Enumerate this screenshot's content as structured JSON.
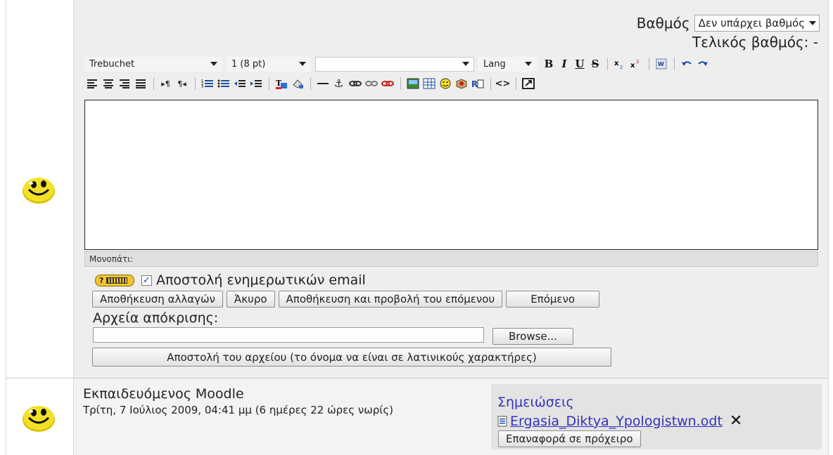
{
  "grading": {
    "grade_label": "Βαθμός",
    "grade_select_value": "Δεν υπάρχει βαθμός",
    "final_grade": "Τελικός βαθμός: -"
  },
  "editor": {
    "font_family": "Trebuchet",
    "font_size": "1 (8 pt)",
    "style_select": "",
    "lang_select": "Lang",
    "bold": "B",
    "italic": "I",
    "underline": "U",
    "strike": "S",
    "path_label": "Μονοπάτι:"
  },
  "feedback": {
    "email_label": "Αποστολή ενημερωτικών email",
    "email_checked": true,
    "save_button": "Αποθήκευση αλλαγών",
    "cancel_button": "Άκυρο",
    "save_next_button": "Αποθήκευση και προβολή του επόμενου",
    "next_button": "Επόμενο"
  },
  "response_files": {
    "label": "Αρχεία απόκρισης:",
    "browse_button": "Browse...",
    "upload_button": "Αποστολή του αρχείου (το όνομα να είναι σε λατινικούς χαρακτήρες)"
  },
  "submission": {
    "student_name": "Εκπαιδευόμενος Moodle",
    "date_text": "Τρίτη, 7 Ιούλιος 2009, 04:41 μμ (6 ημέρες 22 ώρες νωρίς)",
    "notes_link": "Σημειώσεις",
    "file_name": "Ergasia_Diktya_Ypologistwn.odt",
    "revert_button": "Επαναφορά σε πρόχειρο"
  },
  "colors": {
    "link": "#3333bb",
    "panel": "#eeeeee",
    "smiley": "#f3e028"
  }
}
